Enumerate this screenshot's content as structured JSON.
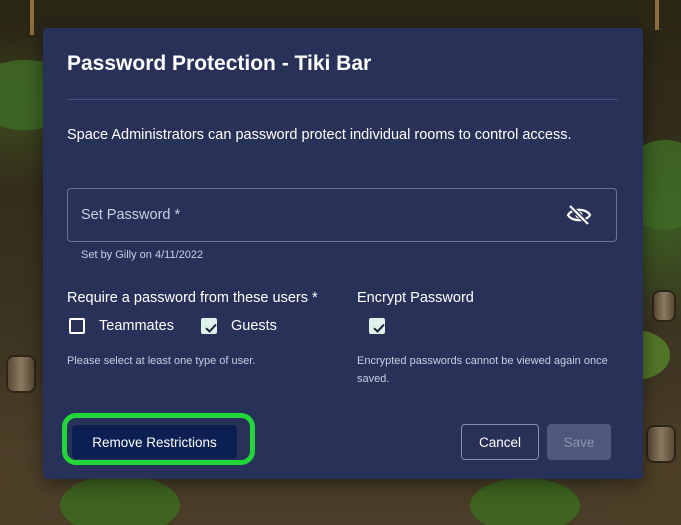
{
  "dialog": {
    "title": "Password Protection - Tiki Bar",
    "description": "Space Administrators can password protect individual rooms to control access.",
    "password_field": {
      "placeholder": "Set Password *",
      "value": "",
      "helper": "Set by Gilly on 4/11/2022",
      "visibility_icon": "eye-slash-icon"
    },
    "require": {
      "label": "Require a password from these users *",
      "options": [
        {
          "label": "Teammates",
          "checked": false
        },
        {
          "label": "Guests",
          "checked": true
        }
      ],
      "note": "Please select at least one type of user."
    },
    "encrypt": {
      "label": "Encrypt Password",
      "checked": true,
      "note": "Encrypted passwords cannot be viewed again once saved."
    },
    "buttons": {
      "remove": "Remove Restrictions",
      "cancel": "Cancel",
      "save": "Save"
    }
  },
  "colors": {
    "modal_bg": "#283157",
    "highlight": "#22d63a",
    "remove_button_bg": "#0b1f52",
    "save_disabled_bg": "#4e587b",
    "checkbox_checked": "#dff3ea"
  }
}
